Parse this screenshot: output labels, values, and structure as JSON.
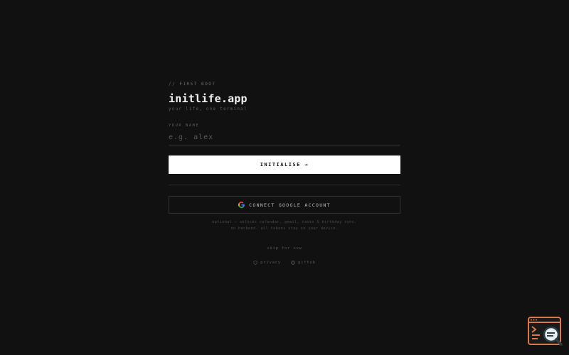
{
  "boot": {
    "label": "// FIRST BOOT"
  },
  "app": {
    "title": "initlife.app",
    "subtitle": "your life, one terminal"
  },
  "name_field": {
    "label": "YOUR NAME",
    "placeholder": "e.g. alex",
    "value": ""
  },
  "initialise_button": {
    "label": "INITIALISE →"
  },
  "google_button": {
    "label": "CONNECT GOOGLE ACCOUNT",
    "icon": "google-icon"
  },
  "note": {
    "line1": "optional — unlocks calendar, gmail, tasks & birthday sync.",
    "line2": "no backend. all tokens stay on your device."
  },
  "skip": {
    "label": "skip for now"
  },
  "footer": {
    "privacy_label": "privacy",
    "privacy_icon": "shield-icon",
    "github_label": "github",
    "github_icon": "github-icon"
  },
  "colors": {
    "background": "#111111",
    "primary_button": "#ffffff",
    "accent_widget": "#d9784a"
  }
}
